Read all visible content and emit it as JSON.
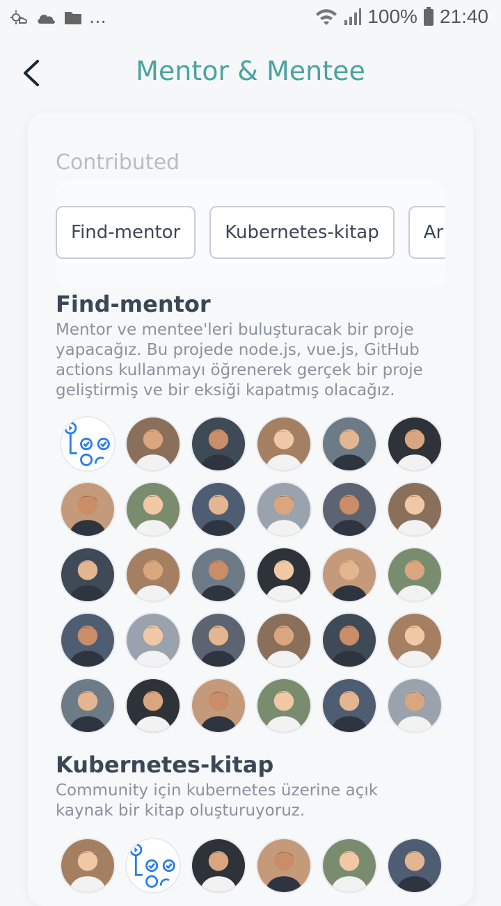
{
  "status_bar": {
    "icons_left": [
      "weather-icon",
      "cloud-icon",
      "folder-icon"
    ],
    "ellipsis": "...",
    "battery": "100%",
    "time": "21:40"
  },
  "header": {
    "title": "Mentor & Mentee"
  },
  "contributed": {
    "label": "Contributed",
    "chips": [
      "Find-mentor",
      "Kubernetes-kitap",
      "Ar"
    ]
  },
  "projects": [
    {
      "title": "Find-mentor",
      "description": "Mentor ve mentee'leri buluşturacak bir proje yapacağız. Bu projede node.js, vue.js, GitHub actions kullanmayı öğrenerek gerçek bir proje geliştirmiş ve bir eksiği kapatmış olacağız.",
      "avatar_count": 30
    },
    {
      "title": "Kubernetes-kitap",
      "description": "Community için kubernetes üzerine açık kaynak bir kitap oluşturuyoruz.",
      "avatar_count": 6
    }
  ]
}
